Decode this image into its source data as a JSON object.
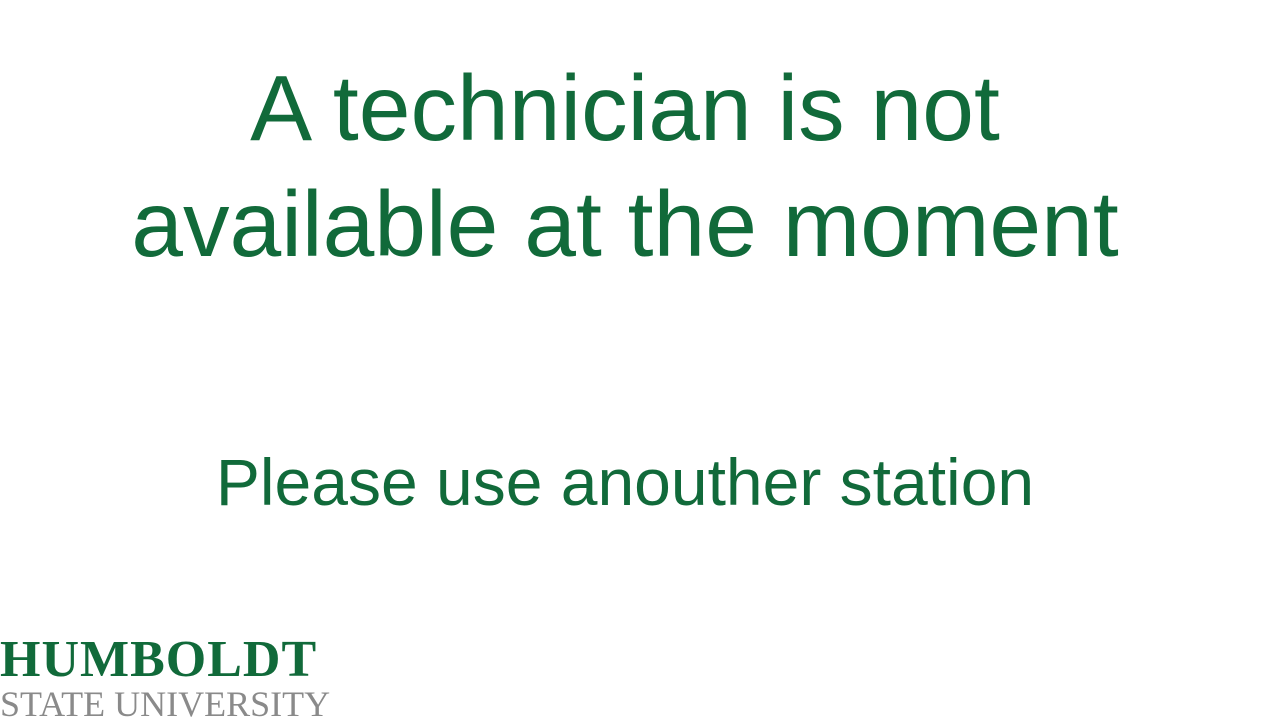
{
  "message": {
    "headline_line1": "A technician is not",
    "headline_line2": "available at the moment",
    "subline": "Please use anouther station"
  },
  "logo": {
    "line1": "HUMBOLDT",
    "line2": "STATE UNIVERSITY"
  },
  "colors": {
    "brand_green": "#116a3a",
    "logo_gray": "#8a8a8a",
    "background": "#ffffff"
  }
}
